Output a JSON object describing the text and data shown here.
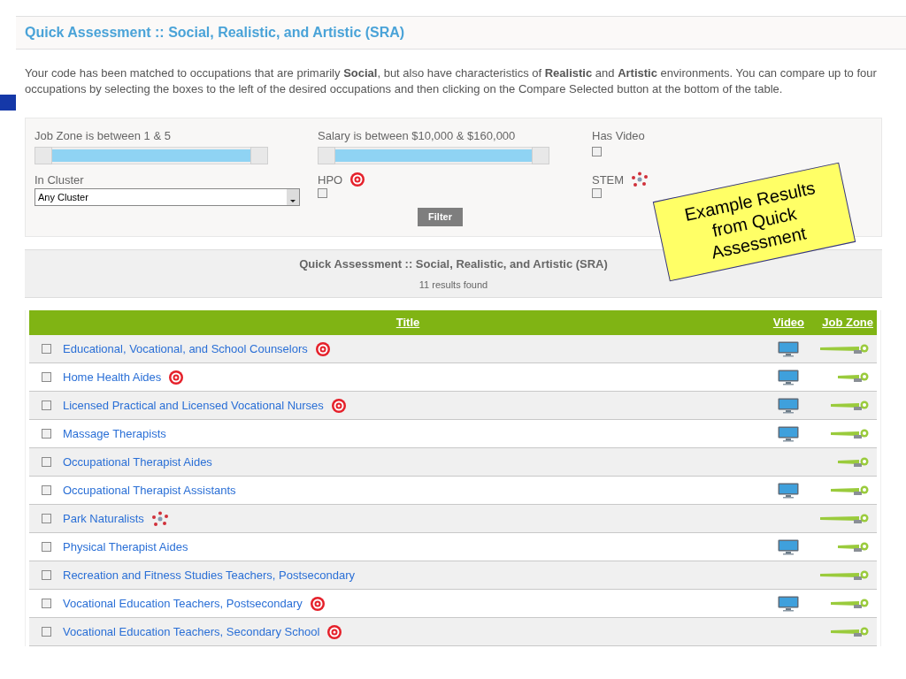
{
  "title": "Quick Assessment :: Social, Realistic, and Artistic (SRA)",
  "intro": "Your code has been matched to occupations that are primarily **Social**, but also have characteristics of **Realistic** and **Artistic** environments. You can compare up to four occupations by selecting the boxes to the left of the desired occupations and then clicking on the Compare Selected button at the bottom of the table.",
  "filters": {
    "job_zone": {
      "label": "Job Zone is between 1 & 5",
      "level": 1
    },
    "salary": {
      "label": "Salary is between $10,000 & $160,000",
      "level": 1
    },
    "has_video": {
      "label": "Has Video",
      "checked": false
    },
    "cluster": {
      "label": "In Cluster",
      "value": "Any Cluster"
    },
    "hpo": {
      "label": "HPO",
      "checked": false
    },
    "stem": {
      "label": "STEM",
      "checked": false
    },
    "filter_button": "Filter"
  },
  "note": "Example Results from Quick Assessment",
  "results": {
    "heading": "Quick Assessment :: Social, Realistic, and Artistic (SRA)",
    "count": "11 results found"
  },
  "table": {
    "columns": [
      "Title",
      "Video",
      "Job Zone"
    ],
    "rows": [
      {
        "title": "Educational, Vocational, and School Counselors",
        "hpo": true,
        "stem": false,
        "video": true,
        "kind": "long",
        "checked": false
      },
      {
        "title": "Home Health Aides",
        "hpo": true,
        "stem": false,
        "video": true,
        "kind": "short",
        "checked": false
      },
      {
        "title": "Licensed Practical and Licensed Vocational Nurses",
        "hpo": true,
        "stem": false,
        "video": true,
        "kind": "medium",
        "checked": false
      },
      {
        "title": "Massage Therapists",
        "hpo": false,
        "stem": false,
        "video": true,
        "kind": "medium",
        "checked": false
      },
      {
        "title": "Occupational Therapist Aides",
        "hpo": false,
        "stem": false,
        "video": false,
        "kind": "short",
        "checked": false
      },
      {
        "title": "Occupational Therapist Assistants",
        "hpo": false,
        "stem": false,
        "video": true,
        "kind": "medium",
        "checked": false
      },
      {
        "title": "Park Naturalists",
        "hpo": false,
        "stem": true,
        "video": false,
        "kind": "long",
        "checked": false
      },
      {
        "title": "Physical Therapist Aides",
        "hpo": false,
        "stem": false,
        "video": true,
        "kind": "short",
        "checked": false
      },
      {
        "title": "Recreation and Fitness Studies Teachers, Postsecondary",
        "hpo": false,
        "stem": false,
        "video": false,
        "kind": "long",
        "checked": false
      },
      {
        "title": "Vocational Education Teachers, Postsecondary",
        "hpo": true,
        "stem": false,
        "video": true,
        "kind": "medium",
        "checked": false
      },
      {
        "title": "Vocational Education Teachers, Secondary School",
        "hpo": true,
        "stem": false,
        "video": false,
        "kind": "medium",
        "checked": false
      }
    ]
  }
}
